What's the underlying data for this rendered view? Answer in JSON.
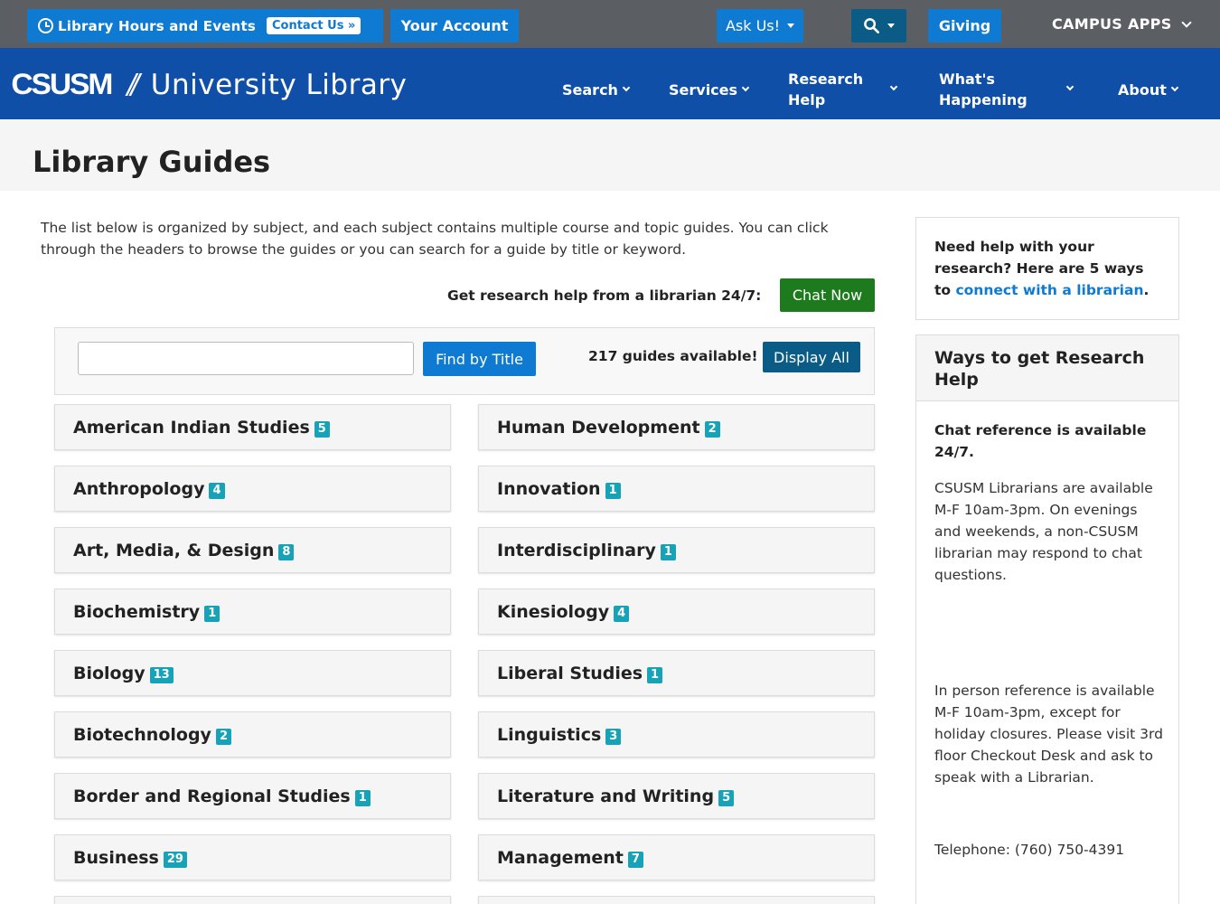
{
  "topbar": {
    "hours_label": "Library Hours and Events",
    "contact_label": "Contact Us »",
    "account_label": "Your Account",
    "ask_label": "Ask Us!",
    "giving_label": "Giving",
    "campus_apps_label": "CAMPUS APPS"
  },
  "brand": {
    "logo": "CSUSM",
    "separator": "//",
    "name": "University Library"
  },
  "nav": {
    "search": "Search",
    "services": "Services",
    "research_help": "Research Help",
    "whats_happening": "What's Happening",
    "about": "About"
  },
  "page": {
    "title": "Library Guides",
    "intro": "The list below is organized by subject, and each subject contains multiple course and topic guides. You can click through the headers to browse the guides or you can search for a guide by title or keyword.",
    "help_text": "Get research help from a librarian 24/7:",
    "chat_now": "Chat Now"
  },
  "search": {
    "input_value": "",
    "find_label": "Find by Title",
    "available_text": "217 guides available!",
    "display_all_label": "Display All"
  },
  "subjects_left": [
    {
      "name": "American Indian Studies",
      "count": "5"
    },
    {
      "name": "Anthropology",
      "count": "4"
    },
    {
      "name": "Art, Media, & Design",
      "count": "8"
    },
    {
      "name": "Biochemistry",
      "count": "1"
    },
    {
      "name": "Biology",
      "count": "13"
    },
    {
      "name": "Biotechnology",
      "count": "2"
    },
    {
      "name": "Border and Regional Studies",
      "count": "1"
    },
    {
      "name": "Business",
      "count": "29"
    }
  ],
  "subjects_right": [
    {
      "name": "Human Development",
      "count": "2"
    },
    {
      "name": "Innovation",
      "count": "1"
    },
    {
      "name": "Interdisciplinary",
      "count": "1"
    },
    {
      "name": "Kinesiology",
      "count": "4"
    },
    {
      "name": "Liberal Studies",
      "count": "1"
    },
    {
      "name": "Linguistics",
      "count": "3"
    },
    {
      "name": "Literature and Writing",
      "count": "5"
    },
    {
      "name": "Management",
      "count": "7"
    }
  ],
  "sidebar": {
    "help_prefix": "Need help with your research? Here are 5 ways to ",
    "help_link": "connect with a librarian",
    "help_suffix": ".",
    "ways_title": "Ways to get Research Help",
    "chat_available": "Chat reference is available 24/7.",
    "chat_details": "CSUSM Librarians are available M-F 10am-3pm. On evenings and weekends, a non-CSUSM librarian may respond to chat questions.",
    "in_person": "In person reference is available M-F 10am-3pm, except for holiday closures. Please visit 3rd floor Checkout Desk and ask to speak with a Librarian.",
    "telephone": "Telephone: (760) 750-4391"
  },
  "colors": {
    "topbar_bg": "#5b5e63",
    "primary_blue": "#0e7ad1",
    "nav_blue": "#0f4fa8",
    "dark_teal": "#0a5c86",
    "chat_green": "#1d7a1d",
    "badge_teal": "#17a2b8"
  }
}
